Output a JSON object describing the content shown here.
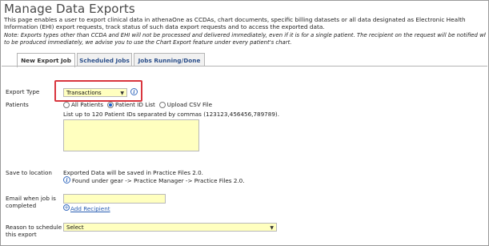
{
  "page": {
    "title": "Manage Data Exports",
    "intro": "This page enables a user to export clinical data in athenaOne as CCDAs, chart documents, specific billing datasets or all data designated as Electronic Health Information (EHI) export requests, track status of such data export requests and to access the exported data.",
    "note_line1": "Note: Exports types other than CCDA and EHI will not be processed and delivered immediately, even if it is for a single patient. The recipient on the request will be notified when the export request",
    "note_line2": "to be produced immediately, we advise you to use the Chart Export feature under every patient's chart."
  },
  "tabs": [
    {
      "label": "New Export Job",
      "active": true
    },
    {
      "label": "Scheduled Jobs",
      "active": false
    },
    {
      "label": "Jobs Running/Done",
      "active": false
    }
  ],
  "form": {
    "export_type": {
      "label": "Export Type",
      "value": "Transactions",
      "info_icon": "info-icon"
    },
    "patients": {
      "label": "Patients",
      "options": [
        "All Patients",
        "Patient ID List",
        "Upload CSV File"
      ],
      "selected": "Patient ID List",
      "hint": "List up to 120 Patient IDs separated by commas (123123,456456,789789).",
      "textarea_value": ""
    },
    "save_location": {
      "label": "Save to location",
      "text": "Exported Data will be saved in Practice Files 2.0.",
      "sub": "Found under gear -> Practice Manager -> Practice Files 2.0."
    },
    "email": {
      "label": "Email when job is completed",
      "value": "",
      "add_recipient": "Add Recipient"
    },
    "reason": {
      "label": "Reason to schedule this export",
      "value": "Select"
    }
  },
  "colors": {
    "input_bg": "#ffffbf",
    "highlight_border": "#d9363e",
    "link": "#2b5fb3",
    "radio_selected": "#1a5ec8"
  }
}
